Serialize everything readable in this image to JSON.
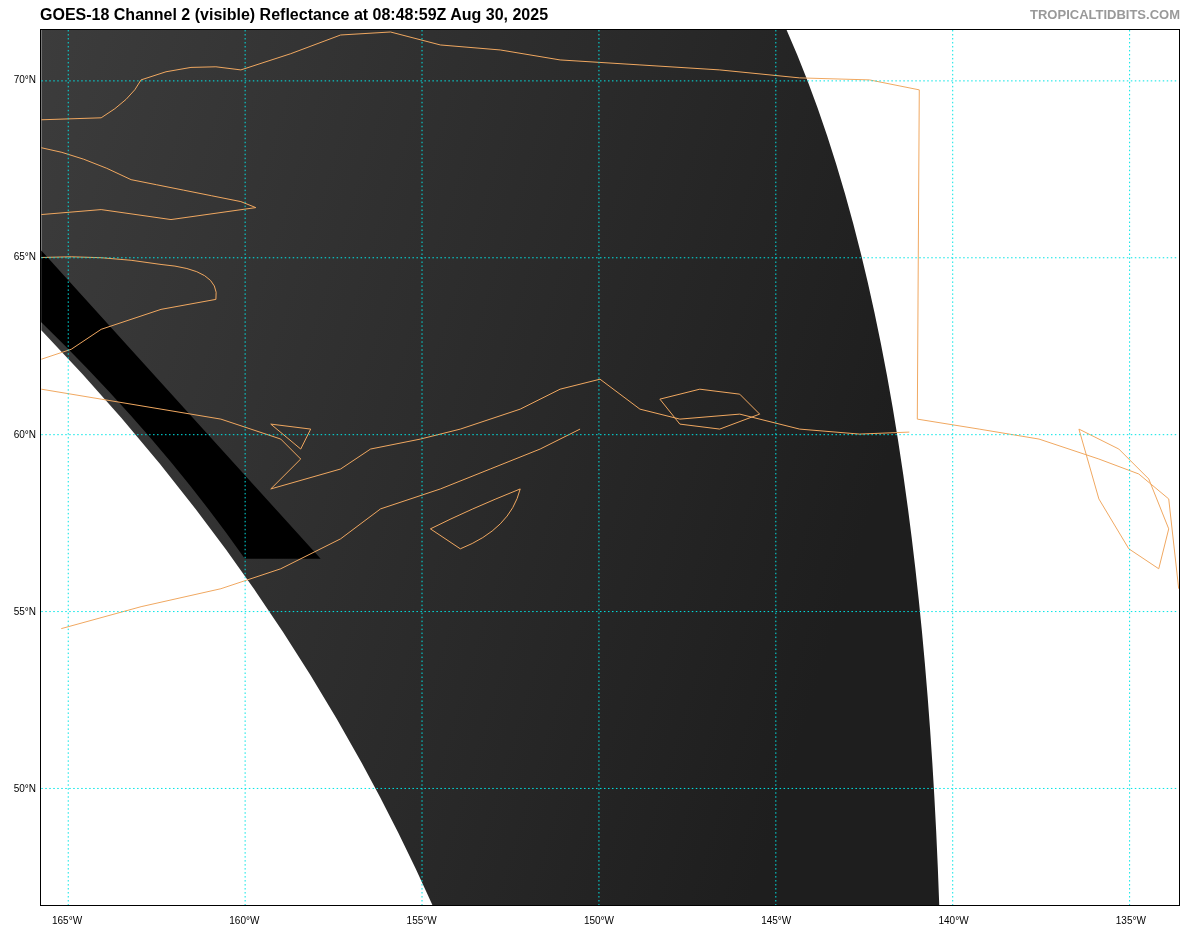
{
  "title": "GOES-18 Channel 2 (visible) Reflectance at 08:48:59Z Aug 30, 2025",
  "credit": "TROPICALTIDBITS.COM",
  "map": {
    "lat_labels": [
      "70°N",
      "65°N",
      "60°N",
      "55°N",
      "50°N"
    ],
    "lon_labels": [
      "165°W",
      "160°W",
      "155°W",
      "150°W",
      "145°W",
      "140°W",
      "135°W"
    ]
  }
}
